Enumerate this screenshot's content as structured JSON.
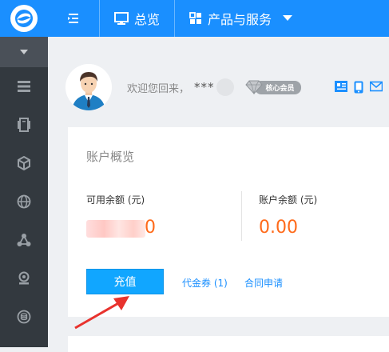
{
  "header": {
    "nav": [
      {
        "label": "总览",
        "icon": "monitor-icon"
      },
      {
        "label": "产品与服务",
        "icon": "grid-icon"
      }
    ]
  },
  "sidebar": {
    "items": [
      {
        "icon": "list-icon"
      },
      {
        "icon": "server-icon"
      },
      {
        "icon": "cube-icon"
      },
      {
        "icon": "globe-icon"
      },
      {
        "icon": "network-icon"
      },
      {
        "icon": "webcam-icon"
      },
      {
        "icon": "database-icon"
      }
    ]
  },
  "profile": {
    "welcome": "欢迎您回来，",
    "username": "***",
    "badge": "核心会员"
  },
  "account": {
    "title": "账户概览",
    "available_label": "可用余额 (元)",
    "available_value_visible": "0",
    "total_label": "账户余额 (元)",
    "total_value": "0.00",
    "recharge_label": "充值",
    "voucher_label": "代金券 (1)",
    "contract_label": "合同申请"
  },
  "colors": {
    "brand": "#1a8fff",
    "sidebar_bg": "#33393f",
    "accent_value": "#ff6a1a",
    "button": "#11a6ff",
    "annotation_arrow": "#e8322d"
  }
}
